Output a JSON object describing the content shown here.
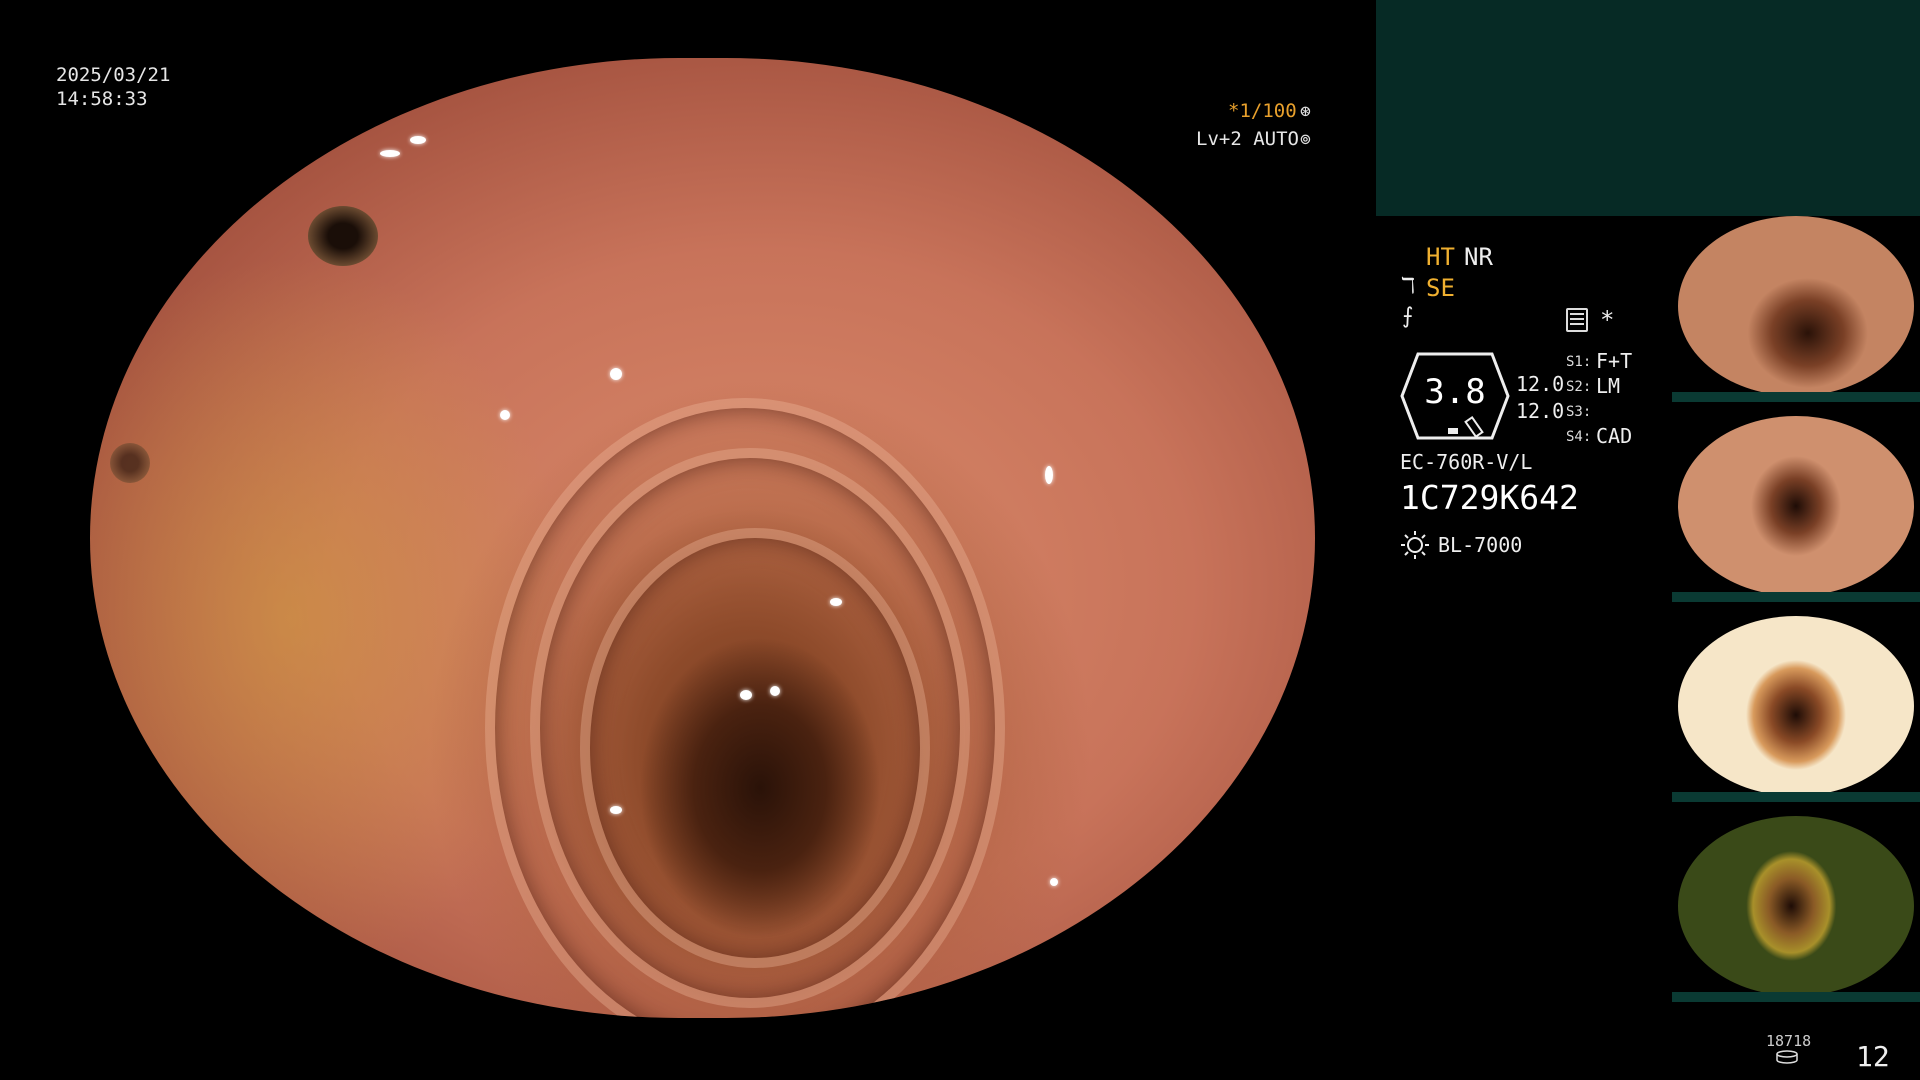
{
  "overlay": {
    "date": "2025/03/21",
    "time": "14:58:33",
    "shutter": "*1/100",
    "shutter_icon": "shutter-icon",
    "level": "Lv+2 AUTO",
    "level_icon": "iris-icon"
  },
  "settings": {
    "ht": "HT",
    "nr": "NR",
    "se": "SE",
    "star": "*",
    "lens_value": "3.8",
    "val_a": "12.0",
    "val_b": "12.0",
    "switches": [
      {
        "key": "S1:",
        "value": "F+T"
      },
      {
        "key": "S2:",
        "value": "LM"
      },
      {
        "key": "S3:",
        "value": ""
      },
      {
        "key": "S4:",
        "value": "CAD"
      }
    ]
  },
  "scope": {
    "model": "EC-760R-V/L",
    "serial": "1C729K642",
    "light_source": "BL-7000"
  },
  "thumbnails": [
    "thumb-1",
    "thumb-2",
    "thumb-3",
    "thumb-4"
  ],
  "counters": {
    "small": "18718",
    "big": "12"
  },
  "colors": {
    "accent_orange": "#f0b030",
    "panel_teal": "#062a25"
  }
}
